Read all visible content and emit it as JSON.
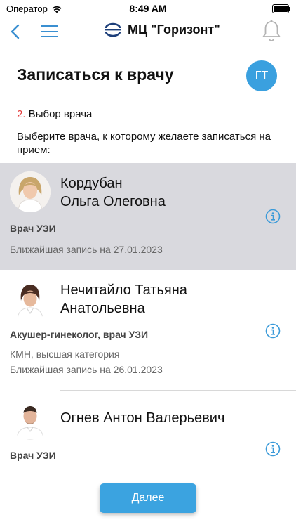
{
  "status_bar": {
    "carrier": "Оператор",
    "time": "8:49 AM"
  },
  "nav": {
    "title": "МЦ \"Горизонт\"",
    "icons": [
      "chevron-left-icon",
      "menu-icon",
      "logo-icon",
      "bell-icon"
    ]
  },
  "header": {
    "title": "Записаться к врачу",
    "user_initials": "ГТ"
  },
  "step": {
    "number": "2.",
    "label": "Выбор врача"
  },
  "instruction": "Выберите врача, к которому желаете записаться на прием:",
  "doctors": [
    {
      "name_line1": "Кордубан",
      "name_line2": "Ольга Олеговна",
      "specialty": "Врач УЗИ",
      "extra": "",
      "nearest": "Ближайшая запись на 27.01.2023",
      "selected": true
    },
    {
      "name_line1": "Нечитайло Татьяна",
      "name_line2": "Анатольевна",
      "specialty": "Акушер-гинеколог, врач УЗИ",
      "extra": "КМН, высшая категория",
      "nearest": "Ближайшая запись на 26.01.2023",
      "selected": false
    },
    {
      "name_line1": "Огнев Антон Валерьевич",
      "name_line2": "",
      "specialty": "Врач УЗИ",
      "extra": "",
      "nearest": "",
      "selected": false
    }
  ],
  "next_button": {
    "label": "Далее"
  },
  "colors": {
    "accent": "#3aa0df",
    "step_number": "#e43b3b",
    "selected_bg": "#d9d9de"
  }
}
